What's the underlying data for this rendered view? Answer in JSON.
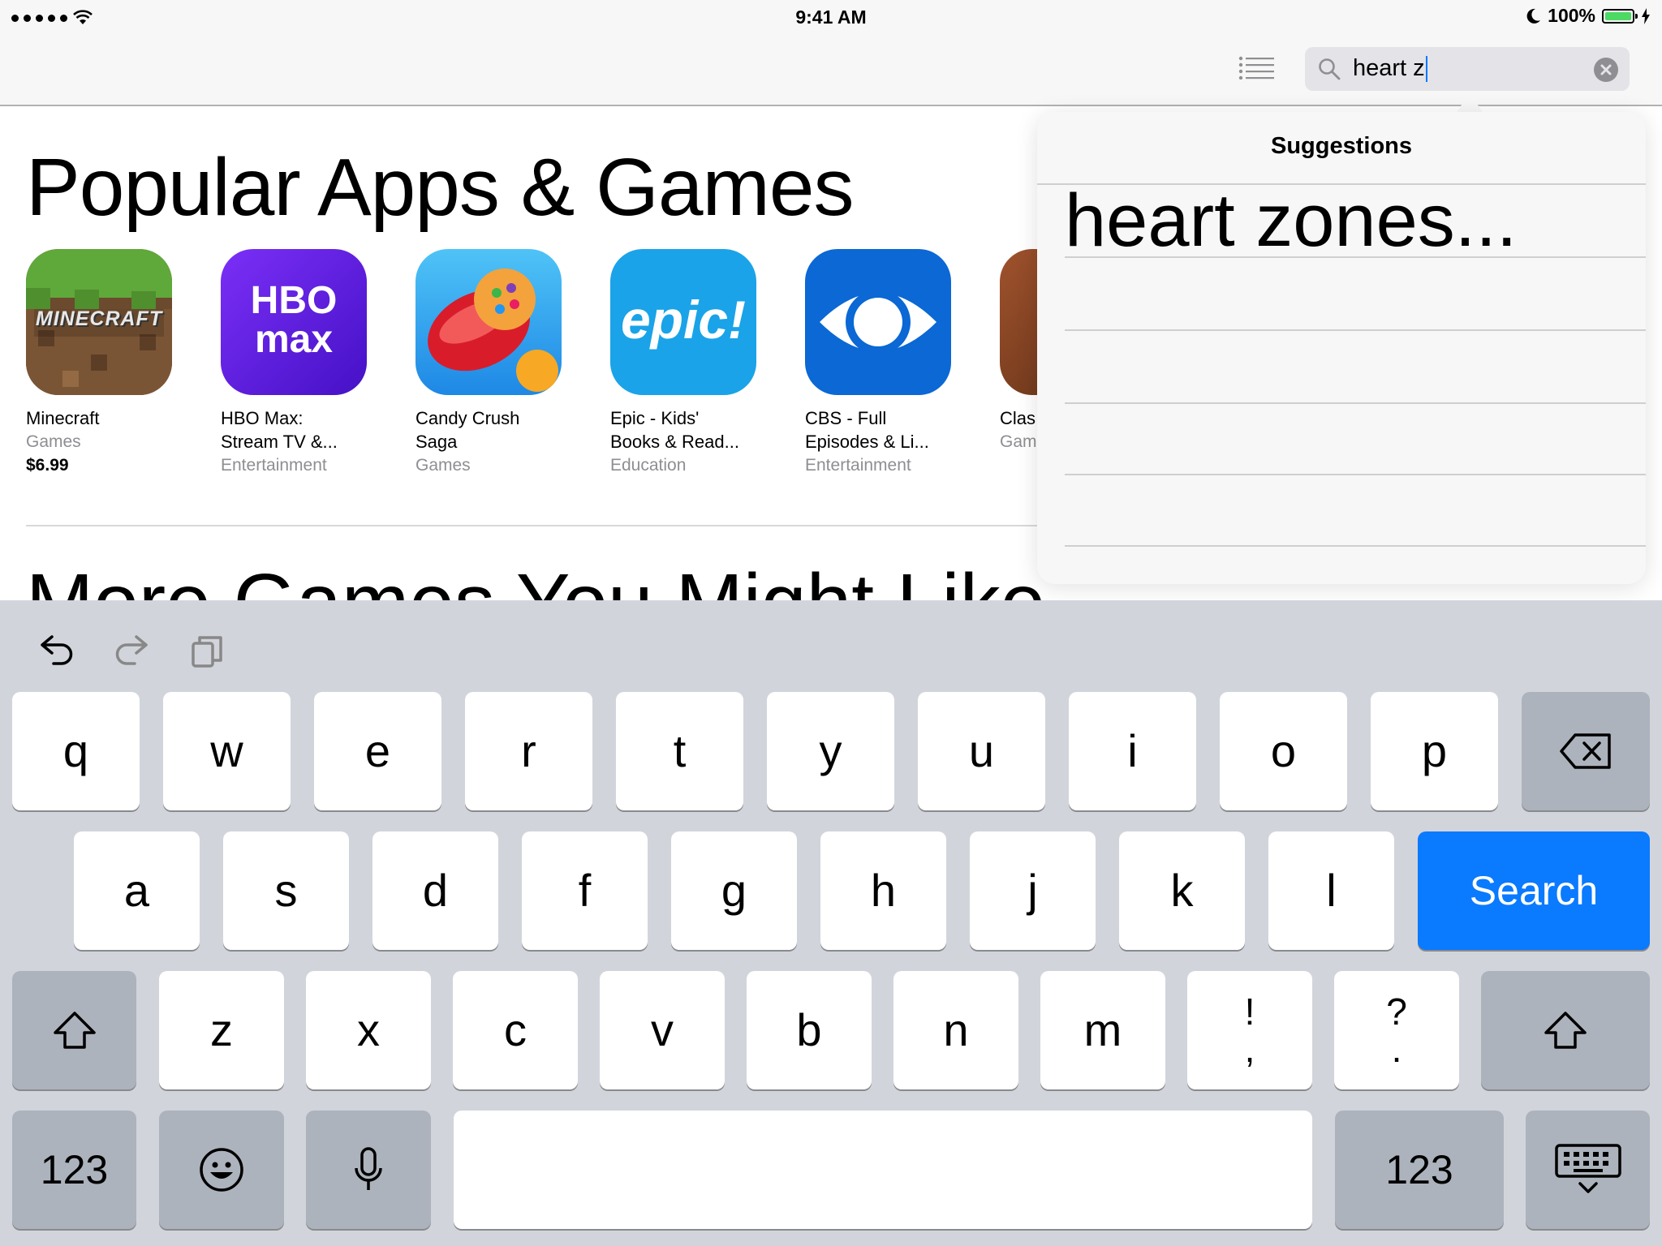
{
  "status_bar": {
    "time": "9:41 AM",
    "battery_percent": "100%",
    "battery_level": 1.0,
    "icons": [
      "signal-dots-icon",
      "wifi-icon",
      "moon-icon",
      "battery-icon",
      "charging-bolt-icon"
    ]
  },
  "nav": {
    "search_value": "heart z",
    "icons": [
      "list-icon",
      "magnifier-icon",
      "clear-icon"
    ]
  },
  "main": {
    "section_title": "Popular Apps & Games",
    "next_section_title": "More Games You Might Like",
    "apps": [
      {
        "name": "Minecraft",
        "category": "Games",
        "price": "$6.99",
        "icon": "minecraft-icon",
        "icon_text": "MINECRAFT",
        "color": "#6b4a2e"
      },
      {
        "name": "HBO Max:\nStream TV &...",
        "category": "Entertainment",
        "price": "",
        "icon": "hbo-max-icon",
        "icon_text": "HBO max",
        "color": "#5a19d8"
      },
      {
        "name": "Candy Crush\nSaga",
        "category": "Games",
        "price": "",
        "icon": "candy-crush-icon",
        "icon_text": "",
        "color": "#d91c2a"
      },
      {
        "name": "Epic - Kids'\nBooks & Read...",
        "category": "Education",
        "price": "",
        "icon": "epic-icon",
        "icon_text": "epic!",
        "color": "#1aa3e8"
      },
      {
        "name": "CBS - Full\nEpisodes & Li...",
        "category": "Entertainment",
        "price": "",
        "icon": "cbs-eye-icon",
        "icon_text": "",
        "color": "#0b68d4"
      },
      {
        "name": "Clas",
        "category": "Gam",
        "price": "",
        "icon": "clash-icon",
        "icon_text": "",
        "color": "#7a3d1e"
      }
    ]
  },
  "suggestions": {
    "title": "Suggestions",
    "items": [
      "heart zones..."
    ]
  },
  "keyboard": {
    "toolbar_icons": [
      "undo-icon",
      "redo-icon",
      "paste-icon"
    ],
    "row1": [
      "q",
      "w",
      "e",
      "r",
      "t",
      "y",
      "u",
      "i",
      "o",
      "p"
    ],
    "row2": [
      "a",
      "s",
      "d",
      "f",
      "g",
      "h",
      "j",
      "k",
      "l"
    ],
    "row3": [
      "z",
      "x",
      "c",
      "v",
      "b",
      "n",
      "m"
    ],
    "row3_punct": [
      {
        "top": "!",
        "bottom": ","
      },
      {
        "top": "?",
        "bottom": "."
      }
    ],
    "search_label": "Search",
    "numbers_label": "123",
    "colors": {
      "accent": "#0a7aff",
      "key": "#ffffff",
      "dark_key": "#acb3bc",
      "background": "#d1d5db"
    }
  }
}
